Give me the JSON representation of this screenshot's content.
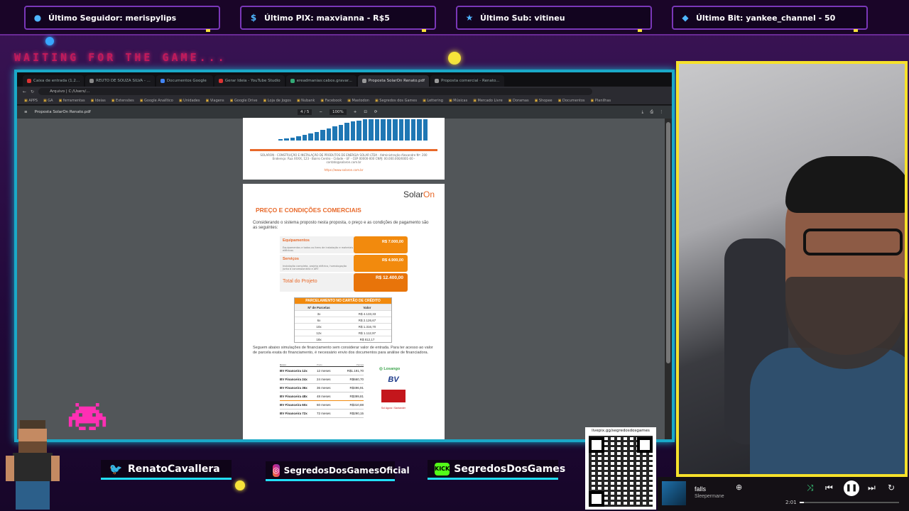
{
  "overlay": {
    "top_stats": [
      {
        "icon": "user-icon",
        "text": "Último Seguidor: merispylips"
      },
      {
        "icon": "dollar-icon",
        "text": "Último PIX: maxvianna - R$5"
      },
      {
        "icon": "star-icon",
        "text": "Último Sub: vitineu"
      },
      {
        "icon": "diamond-icon",
        "text": "Último Bit: yankee_channel - 50"
      }
    ],
    "waiting_text": "WAITING FOR THE GAME...",
    "socials": [
      {
        "icon": "twitter-icon",
        "handle": "RenatoCavallera"
      },
      {
        "icon": "instagram-icon",
        "handle": "SegredosDosGamesOficial"
      },
      {
        "icon": "kick-icon",
        "icon_text": "KICK",
        "handle": "SegredosDosGames"
      }
    ],
    "qr_url": "livepix.gg/segredosdosgames",
    "colors": {
      "frame": "#1aa9c8",
      "cam_frame": "#f6e12b",
      "accent": "#f28a0d"
    }
  },
  "browser": {
    "tabs": [
      "Caixa de entrada (1.2...",
      "REUTO DE SOUZA SILVA - ...",
      "Documentos Google",
      "Gerar Ideia - YouTube Studio",
      "ereadmanias:cabos.gravar...",
      "Proposta SolarOn Renato.pdf",
      "Proposta comercial - Renato..."
    ],
    "active_tab": "Proposta SolarOn Renato.pdf",
    "address": "Arquivo | C:/Users/...",
    "bookmarks": [
      "APPS",
      "GA",
      "ferramentas",
      "Ideias",
      "Extensões",
      "Google Analítico",
      "Unidades",
      "Viagens",
      "Google Drive",
      "Loja de Jogos",
      "Nubank",
      "Facebook",
      "Mastodon",
      "Segredos dos Games",
      "Lettering",
      "Músicas",
      "Mercado Livre",
      "Doramas",
      "Shopee",
      "Documentos",
      "Planilhas"
    ],
    "pdf_title": "Proposta SolarOn Renato.pdf",
    "page_info": "4 / 5",
    "zoom": "100%"
  },
  "pdf": {
    "page1": {
      "chart_heights": [
        0.06,
        0.1,
        0.14,
        0.2,
        0.26,
        0.33,
        0.41,
        0.49,
        0.58,
        0.66,
        0.74,
        0.83,
        0.9,
        0.95,
        1,
        1,
        1,
        1,
        1,
        1,
        1,
        1,
        1,
        1,
        1
      ],
      "footer_text": "SOLARON - CONSTRUÇÃO E INSTALAÇÃO DE PRODUTOS DE ENERGIA SOLAR LTDA - Administração Alexandre Nº: 200 Endereço: Rua XXXX, 123 - Bairro Centro - Cidade - UF - CEP 00000-000 CNPJ: 00.000.000/0001-00 - contato@solaron.com.br",
      "link": "https://www.solaron.com.br"
    },
    "logo_a": "Solar",
    "logo_b": "On",
    "title": "PREÇO E CONDIÇÕES COMERCIAIS",
    "intro": "Considerando o sistema proposto nesta proposta, o preço e as condições de pagamento são as seguintes:",
    "costs": [
      {
        "label": "Equipamentos",
        "desc": "Equipamentos e todos os itens de instalação e materiais elétricos",
        "value": "R$ 7.000,00"
      },
      {
        "label": "Serviços",
        "desc": "Instalação completa, projeto elétrico, homologação junto à concessionária e ART",
        "value": "R$ 4.900,00"
      },
      {
        "label": "Total do Projeto",
        "desc": "",
        "value": "R$ 12.400,00"
      }
    ],
    "installments": {
      "title": "PARCELAMENTO NO CARTÃO DE CRÉDITO",
      "headers": [
        "Nº de Parcelas",
        "Valor"
      ],
      "rows": [
        [
          "3x",
          "R$ 4.133,33"
        ],
        [
          "6x",
          "R$ 2.126,67"
        ],
        [
          "10x",
          "R$ 1.316,70"
        ],
        [
          "12x",
          "R$ 1.112,97"
        ],
        [
          "18x",
          "R$ 812,17"
        ]
      ]
    },
    "financing_intro": "Seguem abaixo simulações de financiamento sem considerar valor de entrada. Para ter acesso ao valor de parcela exata do financiamento, é necessário envio dos documentos para análise de financiadora.",
    "financing_headers": [
      "Banco",
      "Prazo",
      "Parcela"
    ],
    "financing": [
      [
        "BV Financeira 12x",
        "12 meses",
        "R$1.191,70"
      ],
      [
        "BV Financeira 24x",
        "24 meses",
        "R$660,70"
      ],
      [
        "BV Financeira 36x",
        "36 meses",
        "R$496,91"
      ],
      [
        "BV Financeira 48x",
        "48 meses",
        "R$399,81"
      ],
      [
        "BV Financeira 60x",
        "60 meses",
        "R$310,88"
      ],
      [
        "BV Financeira 72x",
        "72 meses",
        "R$290,15"
      ]
    ],
    "banks": {
      "loc": "◎ Losango",
      "bv": "BV",
      "small": "Sol Agora / Santander"
    }
  },
  "music": {
    "song": "falls",
    "artist": "Sleepermane",
    "time": "2:01",
    "progress": 0.04
  }
}
